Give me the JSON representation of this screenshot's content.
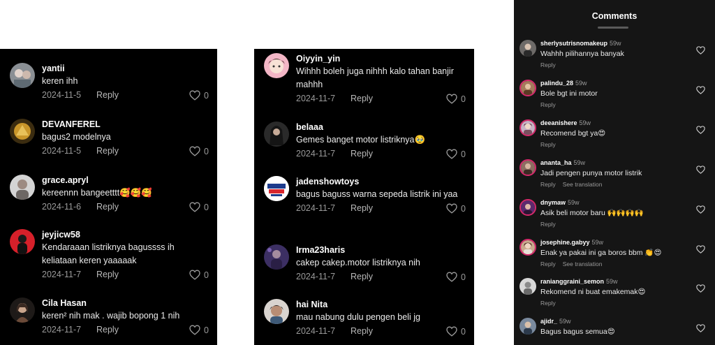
{
  "left_panel": {
    "comments": [
      {
        "user": "yantii",
        "text": "keren ihh",
        "date": "2024-11-5",
        "reply": "Reply",
        "likes": "0",
        "avatar": "avatar-photo"
      },
      {
        "user": "DEVANFEREL",
        "text": "bagus2 modelnya",
        "date": "2024-11-5",
        "reply": "Reply",
        "likes": "0",
        "avatar": "avatar-photo"
      },
      {
        "user": "grace.apryl",
        "text": "kereennn bangeetttt🥰🥰🥰",
        "date": "2024-11-6",
        "reply": "Reply",
        "likes": "0",
        "avatar": "avatar-photo"
      },
      {
        "user": "jeyjicw58",
        "text": "Kendaraaan listriknya bagussss ih keliataan keren yaaaaak",
        "date": "2024-11-7",
        "reply": "Reply",
        "likes": "0",
        "avatar": "avatar-photo"
      },
      {
        "user": "Cila Hasan",
        "text": "keren² nih mak . wajib bopong 1 nih",
        "date": "2024-11-7",
        "reply": "Reply",
        "likes": "0",
        "avatar": "avatar-photo"
      }
    ]
  },
  "middle_panel": {
    "comments": [
      {
        "user": "Oiyyin_yin",
        "text": "Wihhh boleh juga nihhh kalo tahan banjir mahhh",
        "date": "2024-11-7",
        "reply": "Reply",
        "likes": "0",
        "avatar": "avatar-photo"
      },
      {
        "user": "belaaa",
        "text": "Gemes banget motor listriknya🥹",
        "date": "2024-11-7",
        "reply": "Reply",
        "likes": "0",
        "avatar": "avatar-photo"
      },
      {
        "user": "jadenshowtoys",
        "text": "bagus baguss warna sepeda listrik ini yaa",
        "date": "2024-11-7",
        "reply": "Reply",
        "likes": "0",
        "avatar": "avatar-logo"
      },
      {
        "user": "Irma23haris",
        "text": "cakep cakep.motor listriknya nih",
        "date": "2024-11-7",
        "reply": "Reply",
        "likes": "0",
        "avatar": "avatar-photo"
      },
      {
        "user": "hai Nita",
        "text": "mau nabung dulu pengen beli jg",
        "date": "2024-11-7",
        "reply": "Reply",
        "likes": "0",
        "avatar": "avatar-photo"
      }
    ]
  },
  "right_panel": {
    "title": "Comments",
    "comments": [
      {
        "user": "sherlysutrisnomakeup",
        "time": "59w",
        "text": "Wahhh pilihannya banyak",
        "reply": "Reply",
        "translate": ""
      },
      {
        "user": "palindu_28",
        "time": "59w",
        "text": "Bole bgt ini motor",
        "reply": "Reply",
        "translate": ""
      },
      {
        "user": "deeanishere",
        "time": "59w",
        "text": "Recomend bgt ya😍",
        "reply": "Reply",
        "translate": ""
      },
      {
        "user": "ananta_ha",
        "time": "59w",
        "text": "Jadi pengen punya motor listrik",
        "reply": "Reply",
        "translate": "See translation"
      },
      {
        "user": "dnymaw",
        "time": "59w",
        "text": "Asik beli motor baru 🙌🙌🙌🙌",
        "reply": "Reply",
        "translate": ""
      },
      {
        "user": "josephine.gabyy",
        "time": "59w",
        "text": "Enak ya pakai ini ga boros bbm 👏😍",
        "reply": "Reply",
        "translate": "See translation"
      },
      {
        "user": "ranianggraini_semon",
        "time": "59w",
        "text": "Rekomend ni buat emakemak😍",
        "reply": "Reply",
        "translate": ""
      },
      {
        "user": "ajidr_",
        "time": "59w",
        "text": "Bagus bagus semua😍",
        "reply": "",
        "translate": ""
      }
    ]
  },
  "colors": {
    "panel_bg": "#000000",
    "ig_panel_bg": "#151515",
    "text_primary": "#ffffff",
    "text_secondary": "#9a9a9a",
    "story_ring": "#d6296b"
  }
}
